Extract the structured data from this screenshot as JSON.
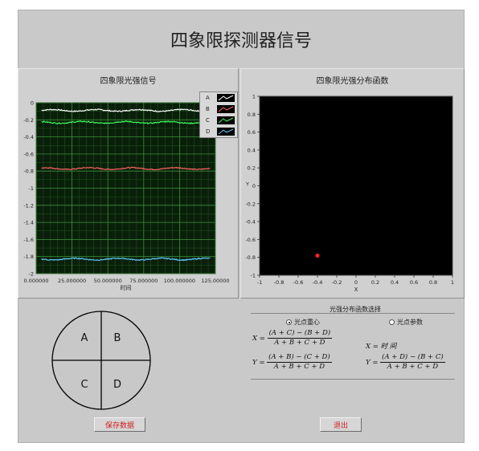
{
  "title": "四象限探测器信号",
  "left_panel": {
    "title": "四象限光强信号"
  },
  "right_panel": {
    "title": "四象限光强分布函数"
  },
  "legend": [
    {
      "label": "A",
      "color": "#ffffff"
    },
    {
      "label": "B",
      "color": "#ff6060"
    },
    {
      "label": "C",
      "color": "#40ff60"
    },
    {
      "label": "D",
      "color": "#60c8ff"
    }
  ],
  "chart_data": [
    {
      "type": "line",
      "title": "四象限光强信号",
      "xlabel": "时间",
      "ylabel": "",
      "xlim": [
        0,
        125
      ],
      "ylim": [
        -2,
        0
      ],
      "x_ticks": [
        "0.000000",
        "25.000000",
        "50.000000",
        "75.000000",
        "100.000000",
        "125.00000"
      ],
      "y_ticks": [
        "0",
        "-0.2",
        "-0.4",
        "-0.6",
        "-0.8",
        "-1",
        "-1.2",
        "-1.4",
        "-1.6",
        "-1.8",
        "-2"
      ],
      "grid": true,
      "legend_position": "top-right",
      "series": [
        {
          "name": "A",
          "color": "#ffffff",
          "level": -0.09
        },
        {
          "name": "B",
          "color": "#ff6060",
          "level": -0.77
        },
        {
          "name": "C",
          "color": "#40ff60",
          "level": -0.23
        },
        {
          "name": "D",
          "color": "#60c8ff",
          "level": -1.83
        }
      ]
    },
    {
      "type": "scatter",
      "title": "四象限光强分布函数",
      "xlabel": "X",
      "ylabel": "Y",
      "xlim": [
        -1,
        1
      ],
      "ylim": [
        -1,
        1
      ],
      "x_ticks": [
        "-1",
        "-0.8",
        "-0.6",
        "-0.4",
        "-0.2",
        "0",
        "0.2",
        "0.4",
        "0.6",
        "0.8",
        "1"
      ],
      "y_ticks": [
        "1",
        "0.8",
        "0.6",
        "0.4",
        "0.2",
        "0",
        "-0.2",
        "-0.4",
        "-0.6",
        "-0.8",
        "-1"
      ],
      "grid": false,
      "points": [
        {
          "x": -0.4,
          "y": -0.78,
          "color": "#ff2020"
        }
      ]
    }
  ],
  "quadrants": {
    "a": "A",
    "b": "B",
    "c": "C",
    "d": "D"
  },
  "selector": {
    "title": "光强分布函数选择",
    "option_centroid": "光点重心",
    "option_params": "光点参数"
  },
  "formulas": {
    "x_lhs": "X =",
    "x_num": "(A + C) − (B + D)",
    "x_den": "A + B + C + D",
    "x_time": "X = 时 间",
    "y_lhs": "Y =",
    "y_num": "(A + B) − (C + D)",
    "y_den": "A + B + C + D",
    "y2_lhs": "Y =",
    "y2_num": "(A + D) − (B + C)",
    "y2_den": "A + B + C + D"
  },
  "buttons": {
    "save": "保存数据",
    "exit": "退出"
  }
}
